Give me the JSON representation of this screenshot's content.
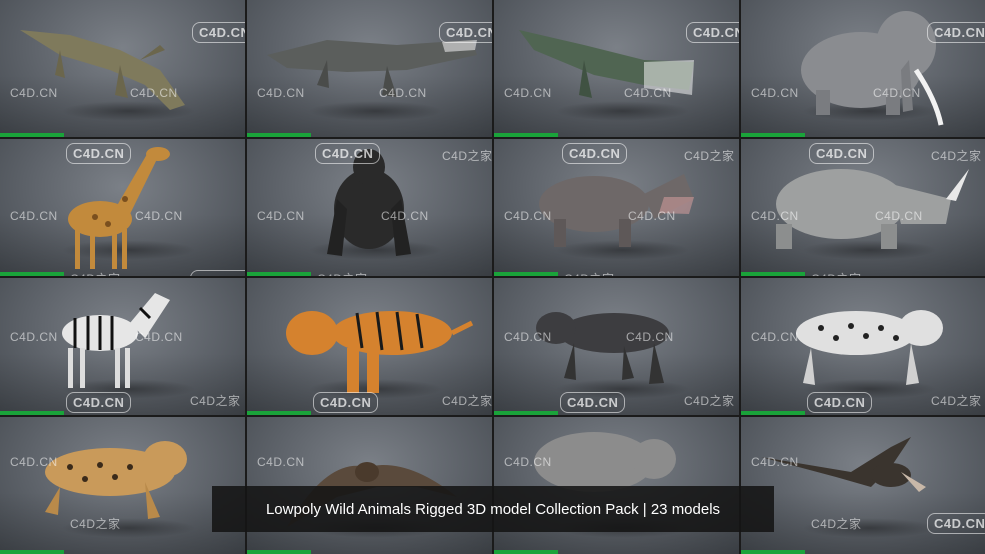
{
  "caption": "Lowpoly Wild Animals Rigged 3D model Collection Pack | 23 models",
  "watermark": {
    "logo": "C4D.CN",
    "site": "C4D.CN",
    "home": "C4D之家"
  },
  "tiles": [
    {
      "animal": "crocodile-1",
      "color": "#7f7a5c"
    },
    {
      "animal": "crocodile-2",
      "color": "#5b5e5c"
    },
    {
      "animal": "crocodile-3",
      "color": "#506552"
    },
    {
      "animal": "elephant",
      "color": "#8a8c90"
    },
    {
      "animal": "giraffe",
      "color": "#c28a3c"
    },
    {
      "animal": "gorilla",
      "color": "#2a2a2a"
    },
    {
      "animal": "hippo",
      "color": "#6e6868"
    },
    {
      "animal": "rhino",
      "color": "#9ea0a0"
    },
    {
      "animal": "zebra",
      "color": "#e6e6e6"
    },
    {
      "animal": "tiger",
      "color": "#d5822e"
    },
    {
      "animal": "panther",
      "color": "#3d3d40"
    },
    {
      "animal": "snow-leopard",
      "color": "#e0e0e0"
    },
    {
      "animal": "leopard",
      "color": "#c99a5a"
    },
    {
      "animal": "bat",
      "color": "#5a4a3c"
    },
    {
      "animal": "warthog",
      "color": "#8c8c8c"
    },
    {
      "animal": "vulture",
      "color": "#3a342e"
    }
  ]
}
